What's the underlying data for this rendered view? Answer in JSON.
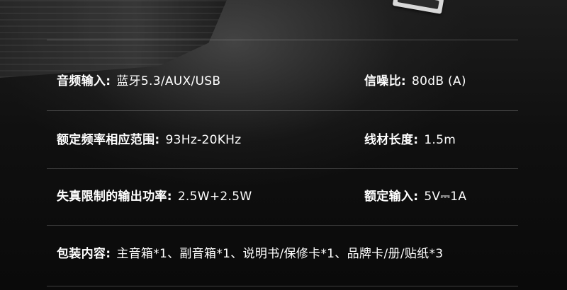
{
  "specs": {
    "rows": [
      {
        "left": {
          "label": "音频输入:",
          "value": "蓝牙5.3/AUX/USB"
        },
        "right": {
          "label": "信噪比:",
          "value": "80dB (A)"
        }
      },
      {
        "left": {
          "label": "额定频率相应范围:",
          "value": "93Hz-20KHz"
        },
        "right": {
          "label": "线材长度:",
          "value": "1.5m"
        }
      },
      {
        "left": {
          "label": "失真限制的输出功率:",
          "value": "2.5W+2.5W"
        },
        "right": {
          "label": "额定输入:",
          "value": "5V⎓1A"
        }
      },
      {
        "left": {
          "label": "包装内容:",
          "value": "主音箱*1、副音箱*1、说明书/保修卡*1、品牌卡/册/贴纸*3"
        }
      }
    ]
  },
  "colors": {
    "background": "#0c0c0c",
    "text": "#ffffff",
    "divider": "#5a5a5a"
  }
}
